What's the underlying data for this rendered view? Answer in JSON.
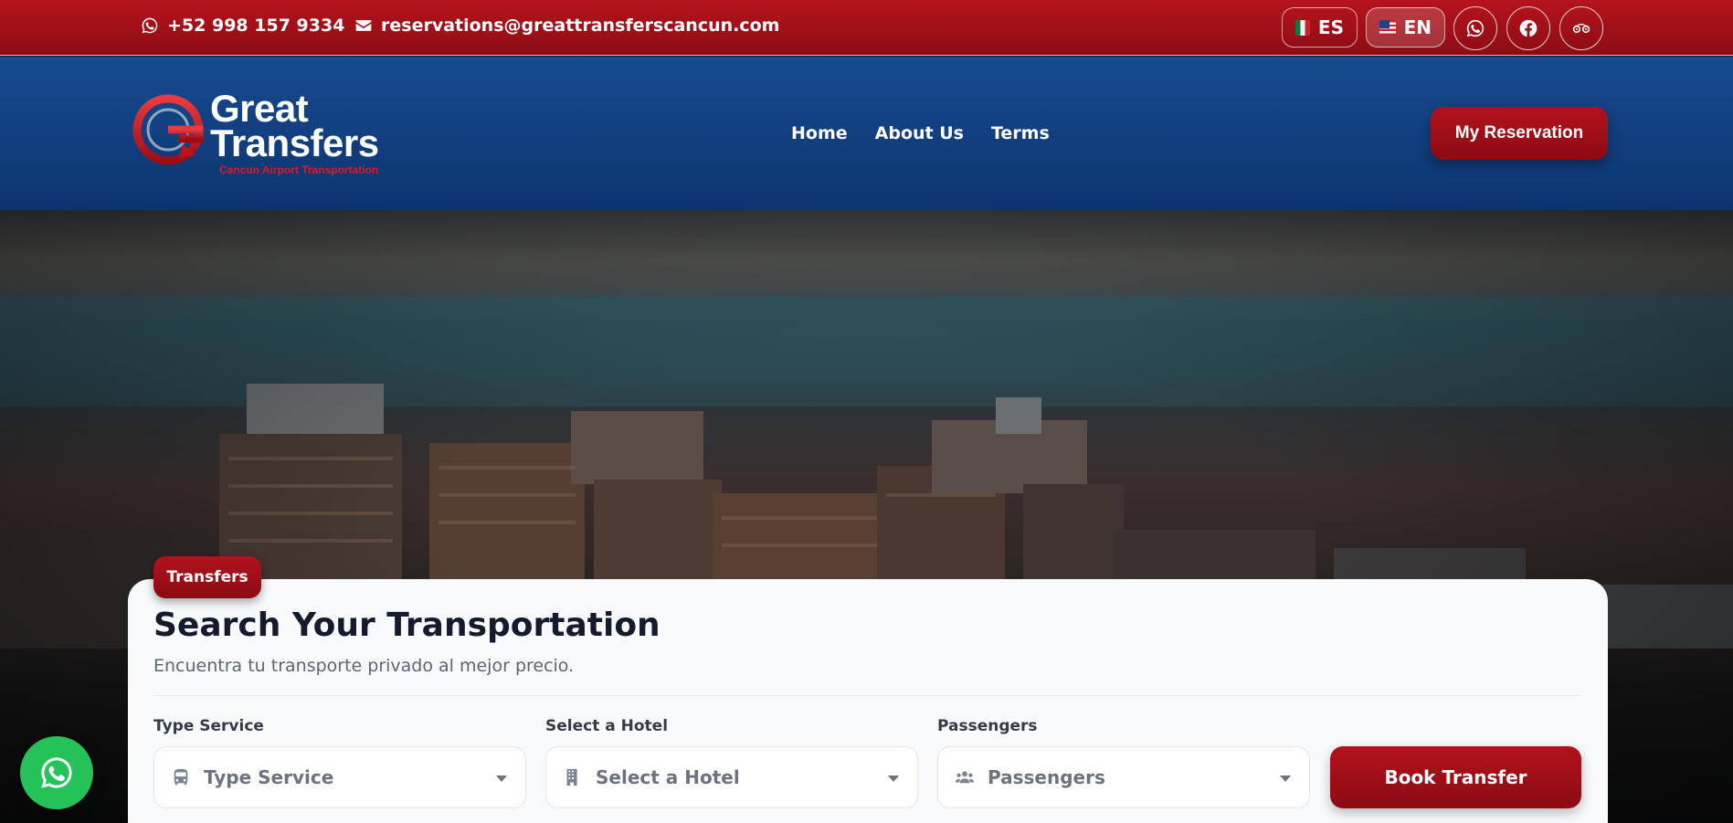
{
  "topbar": {
    "phone": "+52 998 157 9334",
    "email": "reservations@greattransferscancun.com",
    "languages": [
      {
        "code": "ES",
        "flag": "mexico-flag-icon"
      },
      {
        "code": "EN",
        "flag": "usa-flag-icon",
        "active": true
      }
    ],
    "social": [
      "whatsapp-icon",
      "facebook-icon",
      "tripadvisor-icon"
    ]
  },
  "brand": {
    "line1": "Great",
    "line2": "Transfers",
    "tagline": "Cancun Airport Transportation",
    "colors": {
      "red": "#b3121c",
      "blue": "#0c3470"
    }
  },
  "nav": {
    "items": [
      "Home",
      "About Us",
      "Terms"
    ],
    "cta": "My Reservation"
  },
  "search": {
    "badge": "Transfers",
    "title": "Search Your Transportation",
    "subtitle": "Encuentra tu transporte privado al mejor precio.",
    "fields": [
      {
        "label": "Type Service",
        "placeholder": "Type Service",
        "icon": "bus-icon"
      },
      {
        "label": "Select a Hotel",
        "placeholder": "Select a Hotel",
        "icon": "building-icon"
      },
      {
        "label": "Passengers",
        "placeholder": "Passengers",
        "icon": "users-icon"
      }
    ],
    "submit": "Book Transfer"
  },
  "floating": {
    "icon": "whatsapp-icon",
    "color": "#25c25a"
  }
}
